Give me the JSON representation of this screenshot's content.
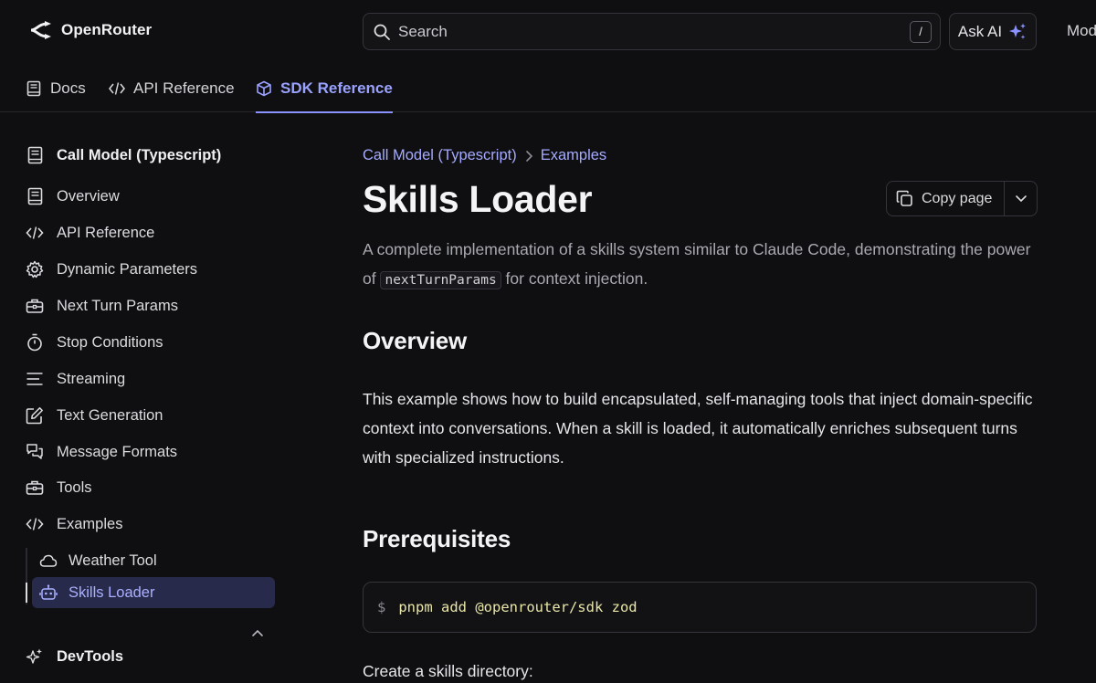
{
  "header": {
    "brand": "OpenRouter",
    "search_placeholder": "Search",
    "search_shortcut": "/",
    "ask_ai_label": "Ask AI",
    "models_partial": "Mod"
  },
  "tabs": [
    {
      "label": "Docs",
      "icon": "book-icon"
    },
    {
      "label": "API Reference",
      "icon": "code-icon"
    },
    {
      "label": "SDK Reference",
      "icon": "cube-icon",
      "active": true
    }
  ],
  "sidebar": {
    "section_title": "Call Model (Typescript)",
    "items": [
      {
        "label": "Overview",
        "icon": "book-icon"
      },
      {
        "label": "API Reference",
        "icon": "code-icon"
      },
      {
        "label": "Dynamic Parameters",
        "icon": "gear-icon"
      },
      {
        "label": "Next Turn Params",
        "icon": "toolbox-icon"
      },
      {
        "label": "Stop Conditions",
        "icon": "stopwatch-icon"
      },
      {
        "label": "Streaming",
        "icon": "lines-icon"
      },
      {
        "label": "Text Generation",
        "icon": "edit-icon"
      },
      {
        "label": "Message Formats",
        "icon": "chat-icon"
      },
      {
        "label": "Tools",
        "icon": "toolbox-icon"
      },
      {
        "label": "Examples",
        "icon": "code-icon",
        "expanded": true
      }
    ],
    "sub_items": [
      {
        "label": "Weather Tool",
        "icon": "cloud-icon"
      },
      {
        "label": "Skills Loader",
        "icon": "robot-icon",
        "active": true
      }
    ],
    "footer_item": {
      "label": "DevTools",
      "icon": "sparkle-icon"
    }
  },
  "main": {
    "breadcrumb": [
      "Call Model (Typescript)",
      "Examples"
    ],
    "title": "Skills Loader",
    "copy_label": "Copy page",
    "lede_before": "A complete implementation of a skills system similar to Claude Code, demonstrating the power of ",
    "lede_code": "nextTurnParams",
    "lede_after": " for context injection.",
    "overview_heading": "Overview",
    "overview_text": "This example shows how to build encapsulated, self-managing tools that inject domain-specific context into conversations. When a skill is loaded, it automatically enriches subsequent turns with specialized instructions.",
    "prereq_heading": "Prerequisites",
    "code_prompt": "$",
    "code_command": "pnpm add @openrouter/sdk zod",
    "next_text": "Create a skills directory:"
  },
  "colors": {
    "background": "#0f0f11",
    "accent": "#9aa2ff",
    "active_bg": "#272a4a",
    "code_command": "#e9e6a8"
  }
}
